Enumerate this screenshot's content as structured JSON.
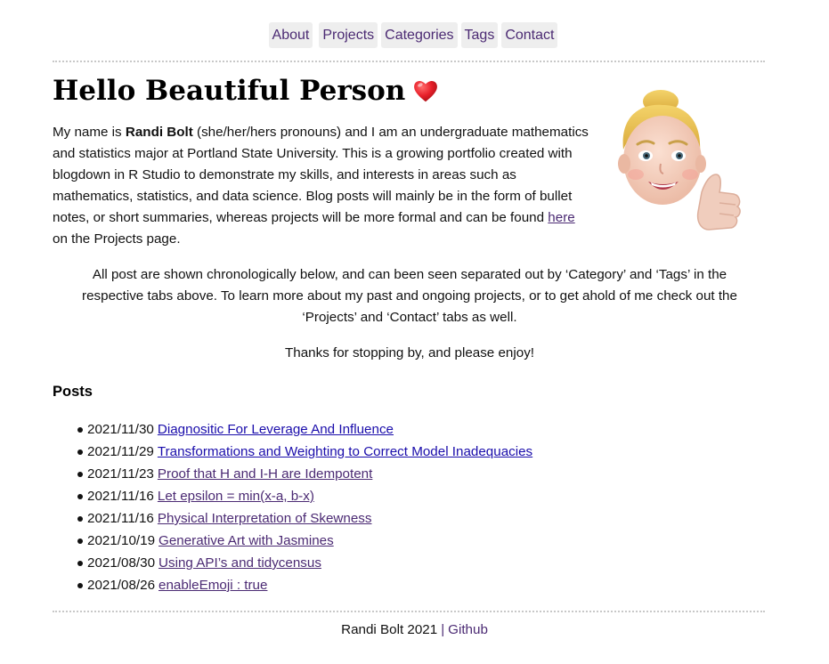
{
  "nav": {
    "items": [
      {
        "label": "About"
      },
      {
        "label": "Projects"
      },
      {
        "label": "Categories"
      },
      {
        "label": "Tags"
      },
      {
        "label": "Contact"
      }
    ]
  },
  "hero": {
    "title": "Hello Beautiful Person",
    "emoji_icon": "red-heart-icon"
  },
  "intro": {
    "part1": "My name is ",
    "name": "Randi Bolt",
    "part2": " (she/her/hers pronouns) and I am an undergraduate mathematics and statistics major at Portland State University. This is a growing portfolio created with blogdown in R Studio to demonstrate my skills, and interests in areas such as mathematics, statistics, and data science. Blog posts will mainly be in the form of bullet notes, or short summaries, whereas projects will be more formal and can be found ",
    "link_label": "here",
    "part3": " on the Projects page."
  },
  "about": {
    "paragraph1": "All post are shown chronologically below, and can been seen separated out by ‘Category’ and ‘Tags’ in the respective tabs above. To learn more about my past and ongoing projects, or to get ahold of me check out the ‘Projects’ and ‘Contact’ tabs as well.",
    "paragraph2": "Thanks for stopping by, and please enjoy!"
  },
  "posts": {
    "heading": "Posts",
    "items": [
      {
        "date": "2021/11/30",
        "title": "Diagnositic For Leverage And Influence"
      },
      {
        "date": "2021/11/29",
        "title": "Transformations and Weighting to Correct Model Inadequacies"
      },
      {
        "date": "2021/11/23",
        "title": "Proof that H and I-H are Idempotent"
      },
      {
        "date": "2021/11/16",
        "title": "Let epsilon = min(x-a, b-x)"
      },
      {
        "date": "2021/11/16",
        "title": "Physical Interpretation of Skewness"
      },
      {
        "date": "2021/10/19",
        "title": "Generative Art with Jasmines"
      },
      {
        "date": "2021/08/30",
        "title": "Using API’s and tidycensus"
      },
      {
        "date": "2021/08/26",
        "title": "enableEmoji : true"
      }
    ]
  },
  "footer": {
    "copyright": "Randi Bolt 2021",
    "separator": "|",
    "link_label": "Github"
  },
  "colors": {
    "link": "#4b2a73",
    "unvisited_link": "#1a0dab",
    "nav_bg": "#eeeeee",
    "divider": "#c8c8c8"
  }
}
